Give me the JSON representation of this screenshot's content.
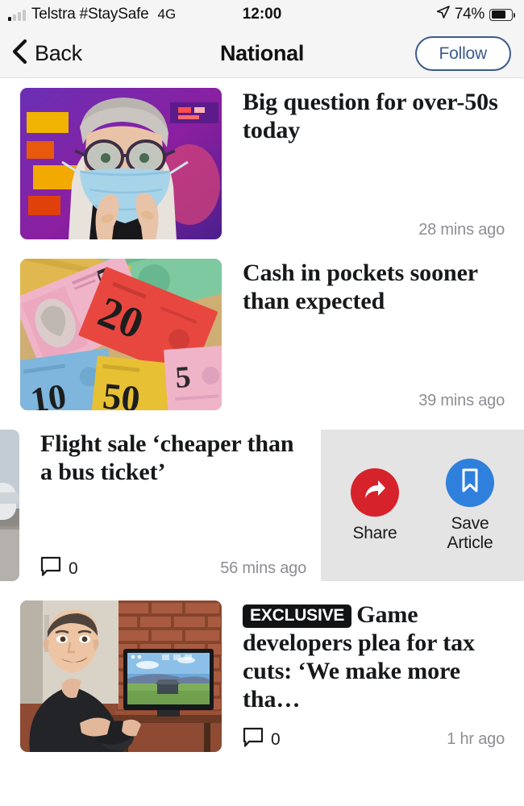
{
  "status_bar": {
    "carrier": "Telstra #StaySafe",
    "network": "4G",
    "time": "12:00",
    "battery_percent": "74%",
    "signal_icon": "signal-bars-icon",
    "location_icon": "location-arrow-icon",
    "battery_icon": "battery-icon",
    "battery_level": 74
  },
  "nav": {
    "back_label": "Back",
    "title": "National",
    "follow_label": "Follow",
    "back_icon": "chevron-left-icon"
  },
  "colors": {
    "share_red": "#d6222b",
    "save_blue": "#2f80dd",
    "follow_border": "#3c5b8b",
    "swipe_panel_bg": "#e4e4e4",
    "badge_bg": "#111315",
    "timestamp_gray": "#8e8e93",
    "header_bg": "#f5f5f5"
  },
  "swipe_actions": [
    {
      "label": "Share",
      "icon": "share-arrow-icon",
      "color": "#d6222b"
    },
    {
      "label": "Save Article",
      "icon": "bookmark-icon",
      "color": "#2f80dd"
    }
  ],
  "articles": [
    {
      "headline": "Big question for over-50s today",
      "timestamp": "28 mins ago",
      "badge": "",
      "comment_count": "",
      "thumbnail": "woman-wearing-face-mask-thermal-camera-photo",
      "swiped": false
    },
    {
      "headline": "Cash in pockets sooner than expected",
      "timestamp": "39 mins ago",
      "badge": "",
      "comment_count": "",
      "thumbnail": "australian-banknotes-photo",
      "swiped": false
    },
    {
      "headline": "Flight sale ‘cheaper than a bus ticket’",
      "timestamp": "56 mins ago",
      "badge": "",
      "comment_count": "0",
      "thumbnail": "aeroplane-on-tarmac-photo",
      "swiped": true
    },
    {
      "headline": "Game developers plea for tax cuts: ‘We make more tha…",
      "timestamp": "1 hr ago",
      "badge": "EXCLUSIVE",
      "comment_count": "0",
      "thumbnail": "man-holding-game-controller-photo",
      "swiped": false
    }
  ]
}
